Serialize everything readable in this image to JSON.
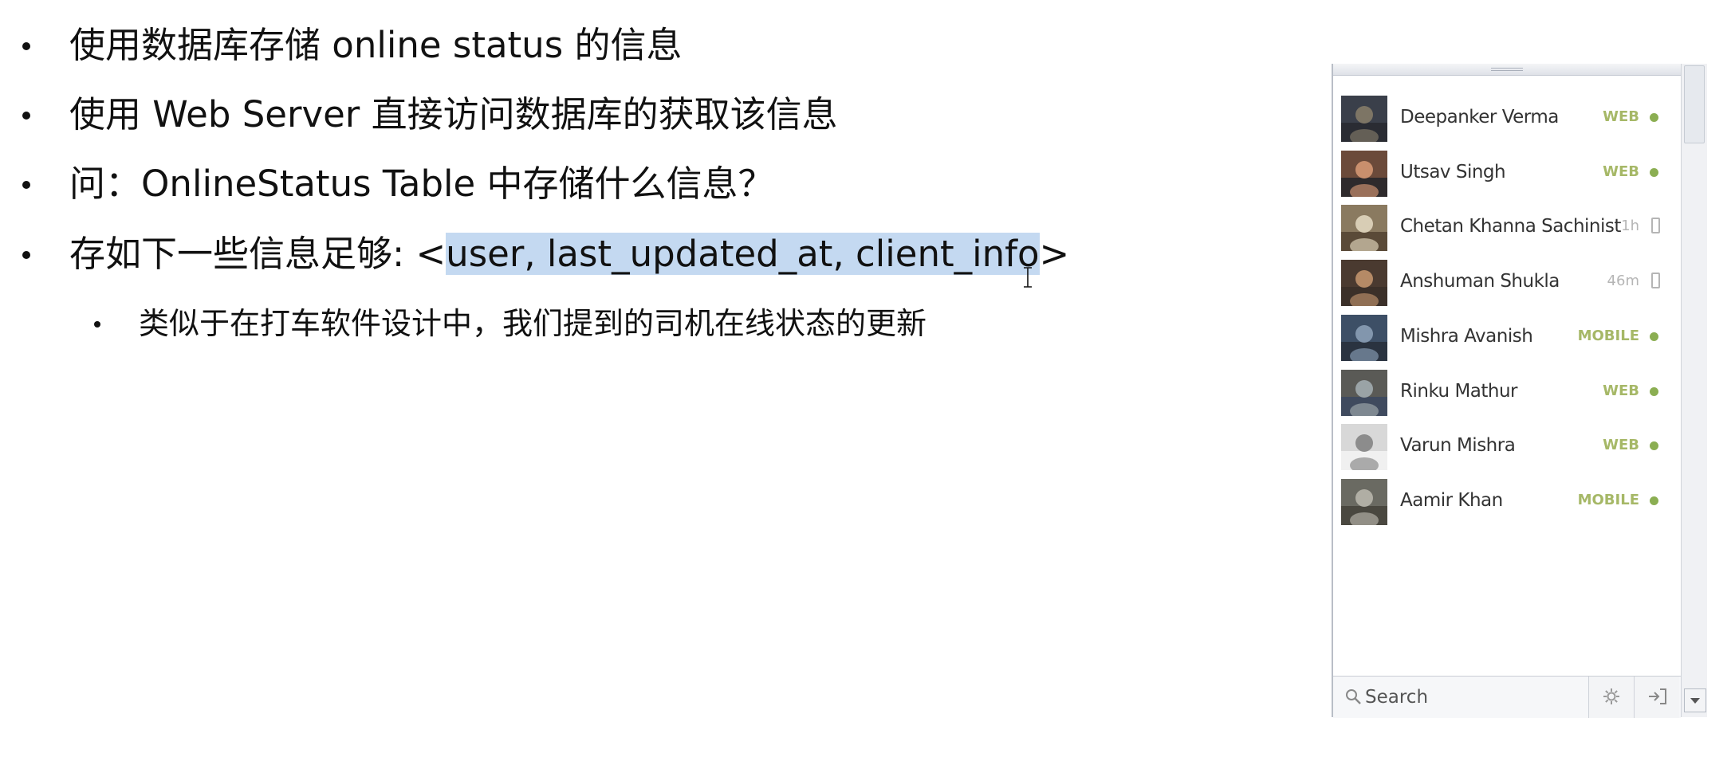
{
  "slide": {
    "bullets": [
      "使用数据库存储 online status 的信息",
      "使用 Web Server 直接访问数据库的获取该信息",
      "问：OnlineStatus Table 中存储什么信息？",
      {
        "before": "存如下一些信息足够: <",
        "highlight": "user, last_updated_at, client_info",
        "after": ">"
      }
    ],
    "sub_bullet": "类似于在打车软件设计中，我们提到的司机在线状态的更新"
  },
  "chat": {
    "friends": [
      {
        "name": "Deepanker Verma",
        "status": "WEB",
        "online": true
      },
      {
        "name": "Utsav Singh",
        "status": "WEB",
        "online": true
      },
      {
        "name": "Chetan Khanna Sachinist",
        "status": "1h",
        "online": false
      },
      {
        "name": "Anshuman Shukla",
        "status": "46m",
        "online": false
      },
      {
        "name": "Mishra Avanish",
        "status": "MOBILE",
        "online": true
      },
      {
        "name": "Rinku Mathur",
        "status": "WEB",
        "online": true
      },
      {
        "name": "Varun Mishra",
        "status": "WEB",
        "online": true
      },
      {
        "name": "Aamir Khan",
        "status": "MOBILE",
        "online": true
      }
    ],
    "search_placeholder": "Search",
    "colors": {
      "status_text": "#a6b867",
      "online_dot": "#8bae52",
      "idle_text": "#b5b5b5",
      "highlight": "#c4d9f1"
    }
  }
}
